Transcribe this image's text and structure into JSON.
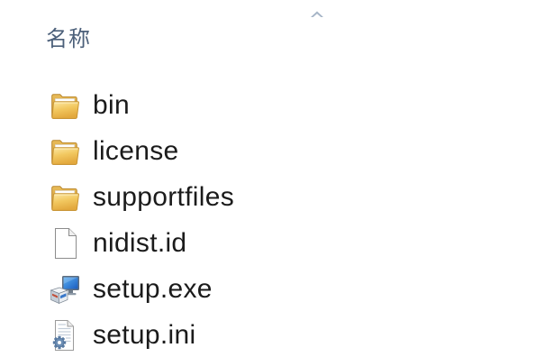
{
  "header": {
    "name_column_label": "名称",
    "sort_icon": "sort-ascending-icon"
  },
  "files": [
    {
      "name": "bin",
      "icon": "folder-icon"
    },
    {
      "name": "license",
      "icon": "folder-icon"
    },
    {
      "name": "supportfiles",
      "icon": "folder-icon"
    },
    {
      "name": "nidist.id",
      "icon": "blank-file-icon"
    },
    {
      "name": "setup.exe",
      "icon": "installer-exe-icon"
    },
    {
      "name": "setup.ini",
      "icon": "settings-file-icon"
    }
  ],
  "colors": {
    "background": "#ffffff",
    "header_text": "#4c607a",
    "item_text": "#1b1b1b",
    "sort_arrow": "#a6b5c7",
    "folder": "#e8b64a"
  }
}
